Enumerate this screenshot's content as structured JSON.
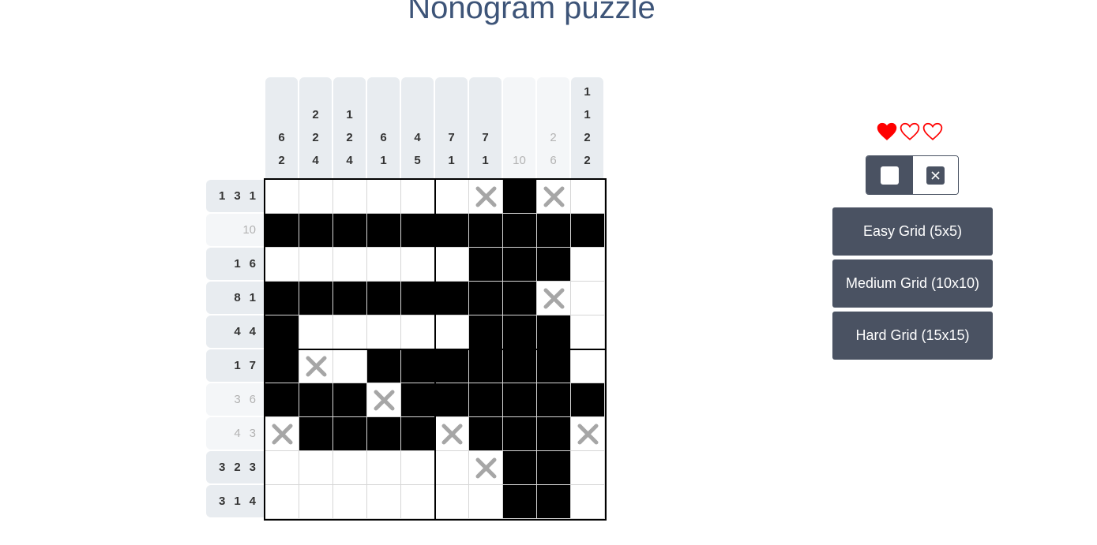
{
  "title": "Nonogram puzzle",
  "col_clues": [
    {
      "nums": [
        "6",
        "2"
      ],
      "done": false
    },
    {
      "nums": [
        "2",
        "2",
        "4"
      ],
      "done": false
    },
    {
      "nums": [
        "1",
        "2",
        "4"
      ],
      "done": false
    },
    {
      "nums": [
        "6",
        "1"
      ],
      "done": false
    },
    {
      "nums": [
        "4",
        "5"
      ],
      "done": false
    },
    {
      "nums": [
        "7",
        "1"
      ],
      "done": false
    },
    {
      "nums": [
        "7",
        "1"
      ],
      "done": false
    },
    {
      "nums": [
        "10"
      ],
      "done": true
    },
    {
      "nums": [
        "2",
        "6"
      ],
      "done": true
    },
    {
      "nums": [
        "1",
        "1",
        "2",
        "2"
      ],
      "done": false
    }
  ],
  "row_clues": [
    {
      "nums": [
        "1",
        "3",
        "1"
      ],
      "done": false
    },
    {
      "nums": [
        "10"
      ],
      "done": true
    },
    {
      "nums": [
        "1",
        "6"
      ],
      "done": false
    },
    {
      "nums": [
        "8",
        "1"
      ],
      "done": false
    },
    {
      "nums": [
        "4",
        "4"
      ],
      "done": false
    },
    {
      "nums": [
        "1",
        "7"
      ],
      "done": false
    },
    {
      "nums": [
        "3",
        "6"
      ],
      "done": true
    },
    {
      "nums": [
        "4",
        "3"
      ],
      "done": true
    },
    {
      "nums": [
        "3",
        "2",
        "3"
      ],
      "done": false
    },
    {
      "nums": [
        "3",
        "1",
        "4"
      ],
      "done": false
    }
  ],
  "grid": [
    "......X#X.",
    "##########",
    "......###.",
    "########X.",
    "#.....###.",
    "#X.######.",
    "###X######",
    "X####X###X",
    "......X##.",
    ".......##."
  ],
  "lives": {
    "total": 3,
    "remaining": 1,
    "color": "#ff0000"
  },
  "mode": {
    "selected": "fill"
  },
  "buttons": {
    "easy": "Easy Grid (5x5)",
    "medium": "Medium Grid (10x10)",
    "hard": "Hard Grid (15x15)"
  },
  "colors": {
    "accent": "#4a5262",
    "title": "#3d5478",
    "cross": "#a6a6a6"
  }
}
